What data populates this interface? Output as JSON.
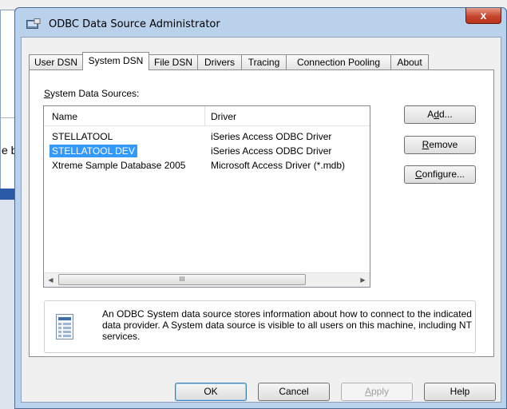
{
  "window": {
    "title": "ODBC Data Source Administrator",
    "close_glyph": "x"
  },
  "background": {
    "fragment_text": "e b"
  },
  "tabs": [
    {
      "label": "User DSN",
      "active": false
    },
    {
      "label": "System DSN",
      "active": true
    },
    {
      "label": "File DSN",
      "active": false
    },
    {
      "label": "Drivers",
      "active": false
    },
    {
      "label": "Tracing",
      "active": false
    },
    {
      "label": "Connection Pooling",
      "active": false
    },
    {
      "label": "About",
      "active": false
    }
  ],
  "panel": {
    "section_label_first": "S",
    "section_label_rest": "ystem Data Sources:",
    "columns": [
      "Name",
      "Driver"
    ],
    "rows": [
      {
        "name": "STELLATOOL",
        "driver": "iSeries Access ODBC Driver",
        "selected": false
      },
      {
        "name": "STELLATOOL DEV",
        "driver": "iSeries Access ODBC Driver",
        "selected": true
      },
      {
        "name": "Xtreme Sample Database 2005",
        "driver": "Microsoft Access Driver (*.mdb)",
        "selected": false
      }
    ],
    "scroll_thumb_glyph": "III",
    "buttons": {
      "add_pre": "A",
      "add_u": "d",
      "add_post": "d...",
      "remove_u": "R",
      "remove_post": "emove",
      "configure_u": "C",
      "configure_post": "onfigure..."
    },
    "info_text": "An ODBC System data source stores information about how to connect to the indicated data provider.   A System data source is visible to all users on this machine, including NT services."
  },
  "footer": {
    "ok": "OK",
    "cancel": "Cancel",
    "apply_u": "A",
    "apply_post": "pply",
    "help": "Help"
  },
  "colors": {
    "selection": "#3399ff",
    "title_close": "#c7452e",
    "frame": "#b9d1ea"
  }
}
